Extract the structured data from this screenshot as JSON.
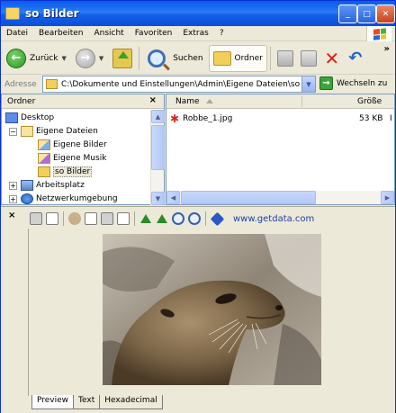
{
  "window": {
    "title": "so Bilder"
  },
  "menu": [
    "Datei",
    "Bearbeiten",
    "Ansicht",
    "Favoriten",
    "Extras",
    "?"
  ],
  "toolbar": {
    "back_label": "Zurück",
    "search_label": "Suchen",
    "folders_label": "Ordner",
    "more": "»"
  },
  "address": {
    "label": "Adresse",
    "value": "C:\\Dokumente und Einstellungen\\Admin\\Eigene Dateien\\so Bilde",
    "go_label": "Wechseln zu"
  },
  "folder_pane": {
    "header": "Ordner",
    "close": "×",
    "tree": [
      {
        "label": "Desktop",
        "icon": "desktop-icon"
      },
      {
        "label": "Eigene Dateien",
        "icon": "documents-folder-icon",
        "expander": "−"
      },
      {
        "label": "Eigene Bilder",
        "icon": "pictures-folder-icon"
      },
      {
        "label": "Eigene Musik",
        "icon": "music-folder-icon"
      },
      {
        "label": "so Bilder",
        "icon": "open-folder-icon",
        "selected": true
      },
      {
        "label": "Arbeitsplatz",
        "icon": "computer-icon",
        "expander": "+"
      },
      {
        "label": "Netzwerkumgebung",
        "icon": "network-icon",
        "expander": "+"
      }
    ]
  },
  "file_list": {
    "columns": [
      "Name",
      "Größe"
    ],
    "files": [
      {
        "name": "Robbe_1.jpg",
        "size": "53 KB",
        "extra": "I"
      }
    ]
  },
  "preview": {
    "close": "×",
    "link": "www.getdata.com",
    "tabs": [
      "Preview",
      "Text",
      "Hexadecimal"
    ],
    "active_tab": "Preview"
  }
}
